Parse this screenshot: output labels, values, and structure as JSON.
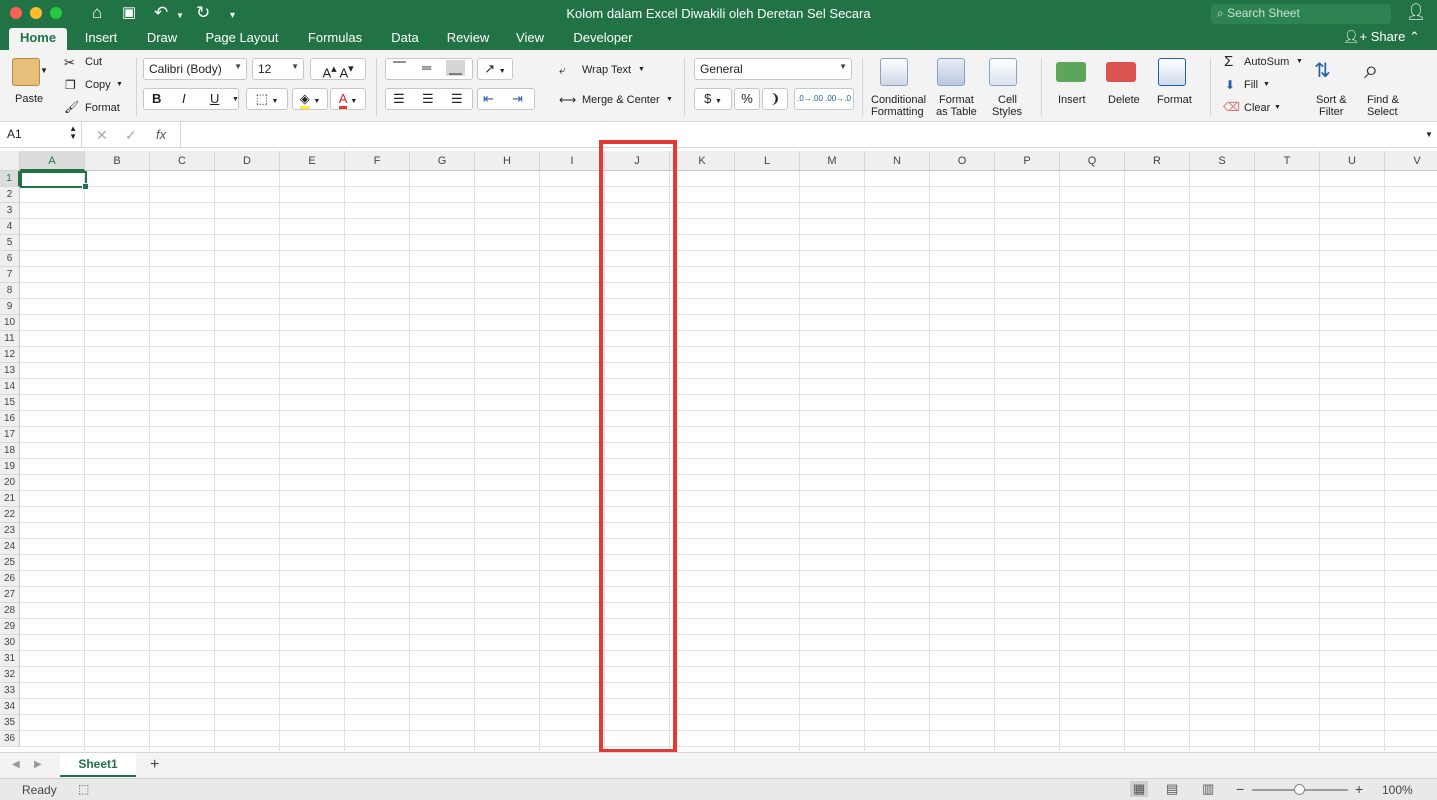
{
  "window": {
    "title": "Kolom dalam Excel Diwakili oleh Deretan Sel Secara"
  },
  "search": {
    "placeholder": "Search Sheet"
  },
  "tabs": [
    "Home",
    "Insert",
    "Draw",
    "Page Layout",
    "Formulas",
    "Data",
    "Review",
    "View",
    "Developer"
  ],
  "share_label": "Share",
  "clipboard": {
    "paste": "Paste",
    "cut": "Cut",
    "copy": "Copy",
    "format": "Format"
  },
  "font": {
    "name": "Calibri (Body)",
    "size": "12",
    "bold": "B",
    "italic": "I",
    "underline": "U"
  },
  "alignment": {
    "wrap": "Wrap Text",
    "merge": "Merge & Center"
  },
  "number": {
    "format": "General",
    "currency": "$",
    "percent": "%",
    "comma": "❩"
  },
  "styles": {
    "conditional_1": "Conditional",
    "conditional_2": "Formatting",
    "table_1": "Format",
    "table_2": "as Table",
    "cell_1": "Cell",
    "cell_2": "Styles"
  },
  "cells": {
    "insert": "Insert",
    "delete": "Delete",
    "format": "Format"
  },
  "editing": {
    "autosum": "AutoSum",
    "fill": "Fill",
    "clear": "Clear",
    "sort_1": "Sort &",
    "sort_2": "Filter",
    "find_1": "Find &",
    "find_2": "Select"
  },
  "formula_bar": {
    "namebox": "A1",
    "fx": "fx",
    "value": ""
  },
  "columns": [
    "A",
    "B",
    "C",
    "D",
    "E",
    "F",
    "G",
    "H",
    "I",
    "J",
    "K",
    "L",
    "M",
    "N",
    "O",
    "P",
    "Q",
    "R",
    "S",
    "T",
    "U",
    "V"
  ],
  "rows": [
    "1",
    "2",
    "3",
    "4",
    "5",
    "6",
    "7",
    "8",
    "9",
    "10",
    "11",
    "12",
    "13",
    "14",
    "15",
    "16",
    "17",
    "18",
    "19",
    "20",
    "21",
    "22",
    "23",
    "24",
    "25",
    "26",
    "27",
    "28",
    "29",
    "30",
    "31",
    "32",
    "33",
    "34",
    "35",
    "36"
  ],
  "selected_cell": "A1",
  "highlighted_column": "J",
  "sheet_tab": "Sheet1",
  "add_sheet": "+",
  "status": {
    "ready": "Ready",
    "zoom": "100%",
    "zoom_out": "−",
    "zoom_in": "+"
  },
  "colors": {
    "accent": "#217346",
    "highlight": "#e53935"
  }
}
